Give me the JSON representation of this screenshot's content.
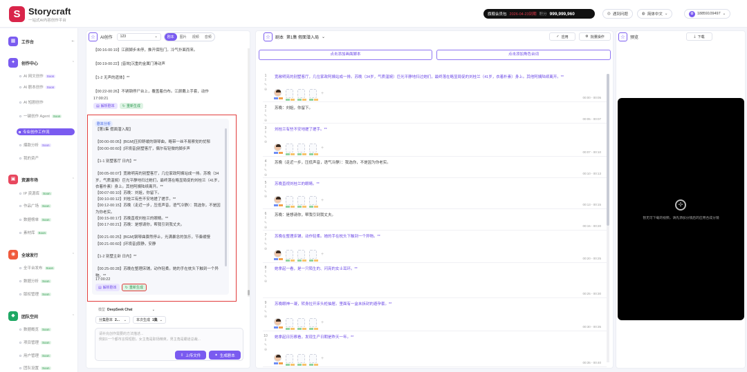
{
  "app": {
    "brand": "Storycraft",
    "slogan": "一站式AI内容创作平台"
  },
  "header": {
    "vip_label": "旗舰会员包",
    "vip_date": "2026-04-23到期",
    "points_label": "积分",
    "points": "999,999,960",
    "help": "遇到问题",
    "language": "简体中文",
    "user": "18859109497"
  },
  "sidebar": {
    "workspace": "工作台",
    "groups": [
      {
        "label": "创作中心",
        "color": "#7a5bf0",
        "icon": "✦"
      },
      {
        "label": "资源市场",
        "color": "#e8475e",
        "icon": "▣"
      },
      {
        "label": "全球发行",
        "color": "#f05a3c",
        "icon": "◉"
      },
      {
        "label": "团队空间",
        "color": "#1fa864",
        "icon": "◆"
      }
    ],
    "create_items": [
      {
        "label": "AI 网文创作",
        "tag": "Soon"
      },
      {
        "label": "AI 剧本创作",
        "tag": "Soon"
      },
      {
        "label": "AI 短剧创作",
        "tag": ""
      },
      {
        "label": "一键创作 Agent",
        "tag": "Soon"
      },
      {
        "label": "专业创作工作流",
        "tag": ""
      },
      {
        "label": "爆款分析",
        "tag": "Soon"
      },
      {
        "label": "我的资产",
        "tag": ""
      }
    ],
    "market_items": [
      {
        "label": "IP 资源库",
        "tag": "Soon"
      },
      {
        "label": "作品广场",
        "tag": "Soon"
      },
      {
        "label": "数据榜单",
        "tag": "Soon"
      },
      {
        "label": "素材库",
        "tag": "Soon"
      }
    ],
    "global_items": [
      {
        "label": "全平台发布",
        "tag": "Soon"
      },
      {
        "label": "数据分析",
        "tag": "Soon"
      },
      {
        "label": "版权管理",
        "tag": "Soon"
      }
    ],
    "team_items": [
      {
        "label": "数据概览",
        "tag": "Soon"
      },
      {
        "label": "项目管理",
        "tag": "Soon"
      },
      {
        "label": "用户管理",
        "tag": "Soon"
      },
      {
        "label": "团队设置",
        "tag": "Soon"
      }
    ]
  },
  "ai_panel": {
    "title": "AI创作",
    "select_value": "123",
    "modes": [
      "剧本",
      "图片",
      "视频",
      "音频"
    ],
    "top_msg": "【00:16-00:19】江颜脚步未停，推开保险门。冷气扑面而来。\n\n【00:19-00:22】[音效]沉重的金属门滑动声\n\n【1-2 无声的遗体】**\n\n  【00:22-00:26】不锈钢停尸台上，覆盖着白布。江颜戴上手套，动作",
    "top_time": "17:00:21",
    "btn_parse": "解析剧本",
    "btn_regen": "重新生成",
    "analysis_tag": "剧本分析",
    "msg": "【第1集 假面潜入局】\n\n【00:00-00:05】[BGM]压抑舒缓的钢琴曲，略带一丝不易察觉的忧郁\n【00:00-00:60】[环境音]别墅客厅，偶尔有轻微的脚步声\n\n【1-1 别墅客厅 日内】**\n\n  【00:05-00:07】宽敞明亮的别墅客厅，几位家政阿姨站成一排。苏晚（34岁，气质温婉）巨光平静地扫过她们，最终落在略显局促的刘桂兰（41岁，衣着朴素）身上。其他阿姨陆续离开。**\n  【00:07-00:10】苏晚：刘姐，你留下。\n  【00:10-00:12】刘桂兰有些不安地搓了搓手。**\n  【00:12-00:15】苏晚（走近一步，压低声音，语气冷静）：我选你，不是因为你老实。\n  【00:15-00:17】苏晚直视刘桂兰的眼睛。**\n  【00:17-00:21】苏晚：是想请你，帮我引到我丈夫。\n\n【00:21-00:25】[BGM]钢琴曲骤然停止，光满暴念的弦乐，节奏缓慢\n【00:21-00:60】[环境音]寂静，安静\n\n【1-2 别墅主卧 日内】**\n\n  【00:25-00:28】苏晚在整理床铺，动作轻柔。她的手在枕头下触到一个异物。**",
    "msg_time": "17:00:22",
    "model_label": "模型",
    "model_value": "DeepSeek Chat",
    "scene_label": "分集剧本",
    "scene_value": "2...",
    "gen_label": "本次生成",
    "gen_value": "1集",
    "placeholder": "请补充创作需要的方法描述...\n例如1一个都市言情短剧，女主角是职场精英，男主角是霸道总裁...",
    "upload": "上传文件",
    "generate": "生成剧本"
  },
  "script_panel": {
    "title": "剧本",
    "episode": "第1集 假面潜入局",
    "apply": "应用",
    "batch": "批量操作",
    "add_scene": "点击添加画面脚本",
    "add_role": "点击添加角色台词",
    "scenes": [
      {
        "n": "1",
        "text": "宽敞明亮的别墅客厅，几位家政阿姨站成一排。苏晚（34岁，气质温婉）巨光平静地扫过她们，最终落在略显局促的刘桂兰（41岁，衣着朴素）身上。其他阿姨陆续离开。**",
        "time": "00:00 - 00:05",
        "purple": true,
        "chars": true
      },
      {
        "n": "2",
        "text": "苏晚：刘姐，你留下。",
        "time": "00:05 - 00:07",
        "purple": false,
        "chars": false
      },
      {
        "n": "3",
        "text": "刘桂兰有些不安地搓了搓手。**",
        "time": "00:07 - 00:10",
        "purple": true,
        "chars": true
      },
      {
        "n": "4",
        "text": "苏晚（走近一步，压低声音，语气冷静）：我选你，不是因为你老实。",
        "time": "00:10 - 00:13",
        "purple": false,
        "chars": false
      },
      {
        "n": "5",
        "text": "苏晚直视刘桂兰的眼睛。**",
        "time": "00:13 - 00:15",
        "purple": true,
        "chars": true
      },
      {
        "n": "6",
        "text": "苏晚：是想请你，帮我引到我丈夫。",
        "time": "00:15 - 00:20",
        "purple": false,
        "chars": false
      },
      {
        "n": "7",
        "text": "苏晚在整理床铺，动作轻柔。她的手在枕头下触到一个异物。**",
        "time": "00:20 - 00:25",
        "purple": true,
        "chars": true
      },
      {
        "n": "8",
        "text": "她拿起一看，是一只陌生的、闪亮的女士耳环。**",
        "time": "00:25 - 00:30",
        "purple": true,
        "chars": false
      },
      {
        "n": "9",
        "text": "苏晚眼神一凝，转身拉开床头柜抽屉。里面有一盒未拆封的避孕套。**",
        "time": "00:30 - 00:35",
        "purple": true,
        "chars": true
      },
      {
        "n": "10",
        "text": "她拿起日历察看，发现生产日期是昨天一年。**",
        "time": "00:35 - 00:40",
        "purple": true,
        "chars": true
      }
    ]
  },
  "preview": {
    "title": "预览",
    "download": "下载",
    "empty": "暂无可下载的视频，请先添加分镜后的应用合成分镜"
  }
}
